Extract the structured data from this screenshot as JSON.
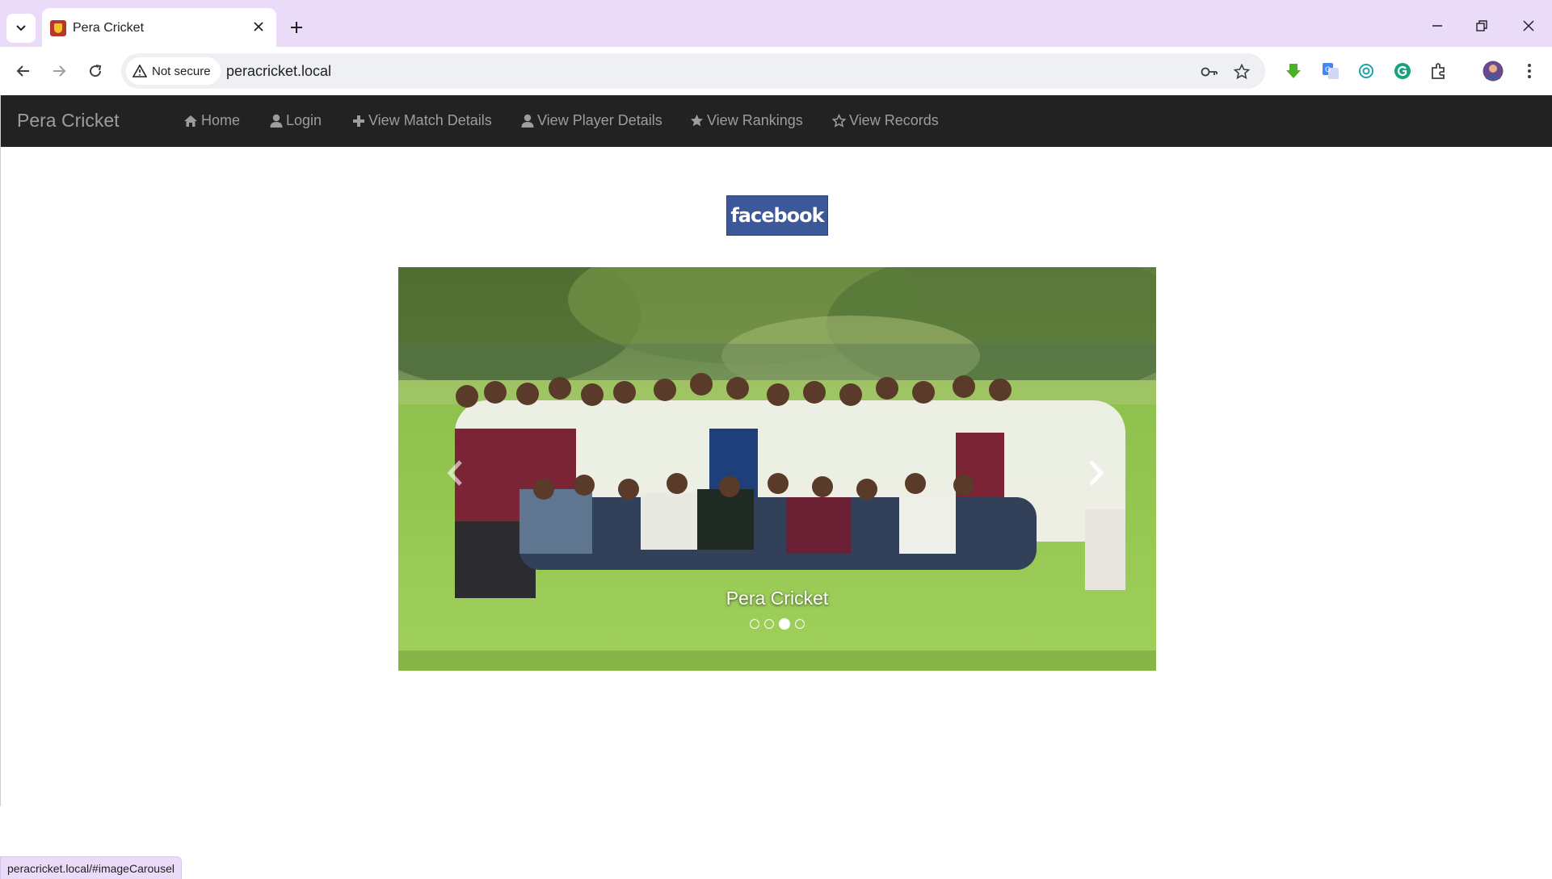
{
  "browser": {
    "tab_title": "Pera Cricket",
    "security_label": "Not secure",
    "url": "peracricket.local",
    "status_url": "peracricket.local/#imageCarousel",
    "icons": {
      "tab_search": "chevron-down-icon",
      "tab_close": "close-icon",
      "new_tab": "plus-icon",
      "back": "back-arrow-icon",
      "forward": "forward-arrow-icon",
      "reload": "reload-icon",
      "warning": "warning-icon",
      "password": "key-icon",
      "bookmark": "star-icon",
      "extensions": [
        "download-extension-icon",
        "translate-extension-icon",
        "openai-extension-icon",
        "grammarly-extension-icon",
        "puzzle-icon"
      ],
      "profile": "avatar",
      "menu": "kebab-menu-icon",
      "minimize": "minimize-icon",
      "restore": "restore-icon",
      "close_window": "close-icon"
    }
  },
  "navbar": {
    "brand": "Pera Cricket",
    "links": [
      {
        "label": "Home",
        "icon": "home-icon"
      },
      {
        "label": "Login",
        "icon": "user-icon"
      },
      {
        "label": "View Match Details",
        "icon": "plus-icon"
      },
      {
        "label": "View Player Details",
        "icon": "user-icon"
      },
      {
        "label": "View Rankings",
        "icon": "star-filled-icon"
      },
      {
        "label": "View Records",
        "icon": "star-outline-icon"
      }
    ]
  },
  "social": {
    "facebook_label": "facebook",
    "color": "#3b5998"
  },
  "carousel": {
    "caption": "Pera Cricket",
    "slide_count": 4,
    "active_index": 2,
    "image_description": "team-photo"
  },
  "colors": {
    "navbar_bg": "#222222",
    "navbar_text": "#9d9d9d",
    "tabstrip_bg": "#eadcf8"
  }
}
